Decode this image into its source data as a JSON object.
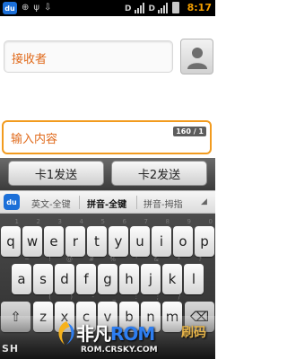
{
  "status_bar": {
    "app_icon": "du-sms-icon",
    "left_icons": [
      "notification-icon",
      "usb-icon",
      "download-icon"
    ],
    "data_indicator": "D",
    "time": "8:17",
    "time_color": "#f5a000"
  },
  "recipient": {
    "placeholder": "接收者",
    "contact_button_icon": "contact-avatar-icon"
  },
  "compose": {
    "placeholder": "输入内容",
    "counter": "160 / 1",
    "accent_color": "#f29b1f"
  },
  "send_buttons": {
    "sim1_label": "卡1发送",
    "sim2_label": "卡2发送"
  },
  "ime": {
    "logo_text": "du",
    "modes": [
      "英文-全键",
      "拼音-全键",
      "拼音-拇指"
    ],
    "active_mode": "拼音-全键"
  },
  "keyboard": {
    "row1": [
      {
        "key": "q",
        "alt": "1"
      },
      {
        "key": "w",
        "alt": "2"
      },
      {
        "key": "e",
        "alt": "3"
      },
      {
        "key": "r",
        "alt": "4"
      },
      {
        "key": "t",
        "alt": "5"
      },
      {
        "key": "y",
        "alt": "6"
      },
      {
        "key": "u",
        "alt": "7"
      },
      {
        "key": "i",
        "alt": "8"
      },
      {
        "key": "o",
        "alt": "9"
      },
      {
        "key": "p",
        "alt": "0"
      }
    ],
    "row2": [
      {
        "key": "a",
        "alt": "~"
      },
      {
        "key": "s",
        "alt": "!"
      },
      {
        "key": "d",
        "alt": "@"
      },
      {
        "key": "f",
        "alt": "#"
      },
      {
        "key": "g",
        "alt": "%"
      },
      {
        "key": "h",
        "alt": "'"
      },
      {
        "key": "j",
        "alt": "&"
      },
      {
        "key": "k",
        "alt": "*"
      },
      {
        "key": "l",
        "alt": "?"
      }
    ],
    "row3": [
      {
        "key": "z",
        "alt": "("
      },
      {
        "key": "x",
        "alt": ")"
      },
      {
        "key": "c",
        "alt": "-"
      },
      {
        "key": "v",
        "alt": "_"
      },
      {
        "key": "b",
        "alt": ":"
      },
      {
        "key": "n",
        "alt": ";"
      },
      {
        "key": "m",
        "alt": "/"
      }
    ],
    "shift_icon": "shift-icon",
    "backspace_icon": "backspace-icon"
  },
  "banner": {
    "left_text": "SH",
    "brand_part1": "非凡",
    "brand_part2": "ROM",
    "domain": "ROM.CRSKY.COM",
    "right_text": "刷码"
  }
}
